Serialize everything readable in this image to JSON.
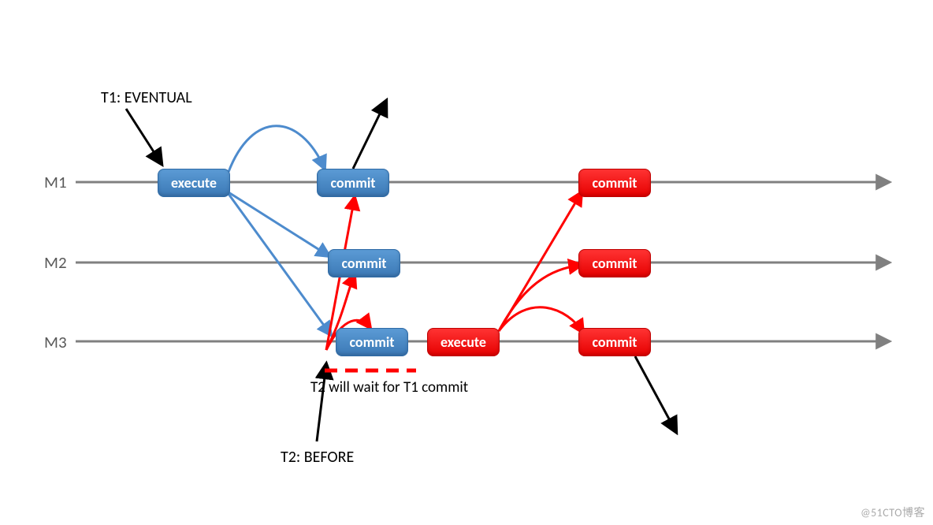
{
  "lanes": {
    "m1": "M1",
    "m2": "M2",
    "m3": "M3"
  },
  "t1": {
    "label": "T1: EVENTUAL",
    "execute": "execute",
    "commit_m1": "commit",
    "commit_m2": "commit",
    "commit_m3": "commit"
  },
  "t2": {
    "label": "T2: BEFORE",
    "execute": "execute",
    "commit_m1": "commit",
    "commit_m2": "commit",
    "commit_m3": "commit",
    "wait_note": "T2 will wait for T1 commit"
  },
  "watermark": "@51CTO博客",
  "colors": {
    "blue": "#4d8bcd",
    "red": "#ff0000",
    "axis": "#808080"
  }
}
